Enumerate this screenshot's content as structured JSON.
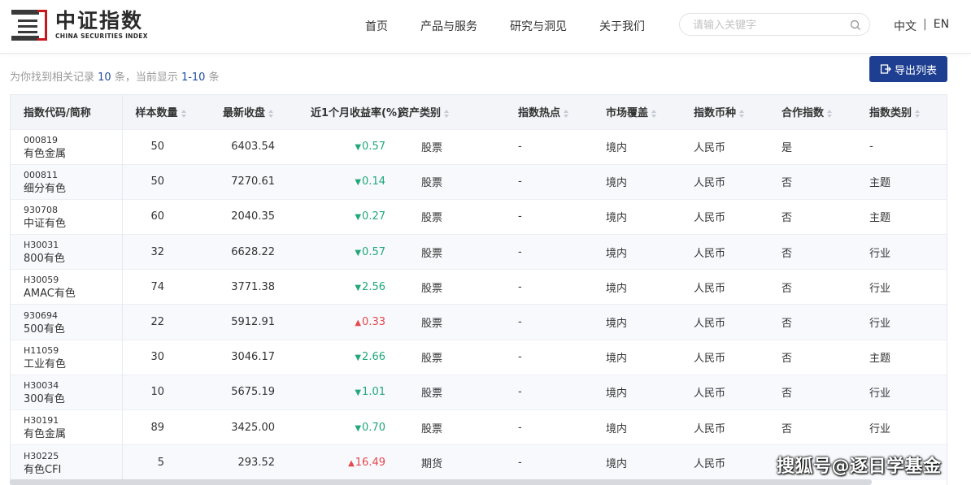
{
  "header": {
    "logo_cn": "中证指数",
    "logo_en": "CHINA SECURITIES INDEX",
    "nav": [
      "首页",
      "产品与服务",
      "研究与洞见",
      "关于我们"
    ],
    "search_placeholder": "请输入关键字",
    "lang_cn": "中文",
    "lang_sep": "|",
    "lang_en": "EN"
  },
  "result": {
    "prefix": "为你找到相关记录 ",
    "count": "10",
    "middle": " 条，当前显示 ",
    "range": "1-10",
    "suffix": " 条"
  },
  "export_label": "导出列表",
  "table": {
    "columns": [
      "指数代码/简称",
      "样本数量",
      "最新收盘",
      "近1个月收益率(%)",
      "资产类别",
      "指数热点",
      "市场覆盖",
      "指数币种",
      "合作指数",
      "指数类别"
    ],
    "rows": [
      {
        "code": "000819",
        "name": "有色金属",
        "samples": "50",
        "close": "6403.54",
        "dir": "down",
        "ret": "0.57",
        "asset": "股票",
        "hot": "-",
        "market": "境内",
        "currency": "人民币",
        "coop": "是",
        "category": "-"
      },
      {
        "code": "000811",
        "name": "细分有色",
        "samples": "50",
        "close": "7270.61",
        "dir": "down",
        "ret": "0.14",
        "asset": "股票",
        "hot": "-",
        "market": "境内",
        "currency": "人民币",
        "coop": "否",
        "category": "主题"
      },
      {
        "code": "930708",
        "name": "中证有色",
        "samples": "60",
        "close": "2040.35",
        "dir": "down",
        "ret": "0.27",
        "asset": "股票",
        "hot": "-",
        "market": "境内",
        "currency": "人民币",
        "coop": "否",
        "category": "主题"
      },
      {
        "code": "H30031",
        "name": "800有色",
        "samples": "32",
        "close": "6628.22",
        "dir": "down",
        "ret": "0.57",
        "asset": "股票",
        "hot": "-",
        "market": "境内",
        "currency": "人民币",
        "coop": "否",
        "category": "行业"
      },
      {
        "code": "H30059",
        "name": "AMAC有色",
        "samples": "74",
        "close": "3771.38",
        "dir": "down",
        "ret": "2.56",
        "asset": "股票",
        "hot": "-",
        "market": "境内",
        "currency": "人民币",
        "coop": "否",
        "category": "行业"
      },
      {
        "code": "930694",
        "name": "500有色",
        "samples": "22",
        "close": "5912.91",
        "dir": "up",
        "ret": "0.33",
        "asset": "股票",
        "hot": "-",
        "market": "境内",
        "currency": "人民币",
        "coop": "否",
        "category": "行业"
      },
      {
        "code": "H11059",
        "name": "工业有色",
        "samples": "30",
        "close": "3046.17",
        "dir": "down",
        "ret": "2.66",
        "asset": "股票",
        "hot": "-",
        "market": "境内",
        "currency": "人民币",
        "coop": "否",
        "category": "主题"
      },
      {
        "code": "H30034",
        "name": "300有色",
        "samples": "10",
        "close": "5675.19",
        "dir": "down",
        "ret": "1.01",
        "asset": "股票",
        "hot": "-",
        "market": "境内",
        "currency": "人民币",
        "coop": "否",
        "category": "行业"
      },
      {
        "code": "H30191",
        "name": "有色金属",
        "samples": "89",
        "close": "3425.00",
        "dir": "down",
        "ret": "0.70",
        "asset": "股票",
        "hot": "-",
        "market": "境内",
        "currency": "人民币",
        "coop": "否",
        "category": "行业"
      },
      {
        "code": "H30225",
        "name": "有色CFI",
        "samples": "5",
        "close": "293.52",
        "dir": "up",
        "ret": "16.49",
        "asset": "期货",
        "hot": "-",
        "market": "境内",
        "currency": "人民币",
        "coop": "",
        "category": ""
      }
    ]
  },
  "colors": {
    "up": "#e5484d",
    "down": "#22a77a",
    "brand": "#1e3f91",
    "logo_red": "#c8161d"
  },
  "watermark": "搜狐号@逐日学基金"
}
